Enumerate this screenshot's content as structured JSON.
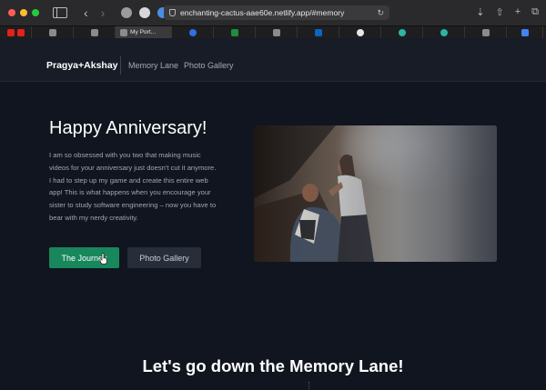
{
  "browser": {
    "url": "enchanting-cactus-aae60e.netlify.app/#memory",
    "active_tab_title": "My Port..."
  },
  "site": {
    "brand": "Pragya+Akshay",
    "nav": [
      "Memory Lane",
      "Photo Gallery"
    ],
    "hero": {
      "title": "Happy Anniversary!",
      "body": "I am so obsessed with you two that making music videos for your anniversary just doesn't cut it anymore. I had to step up my game and create this entire web app! This is what happens when you encourage your sister to study software engineering – now you have to bear with my nerdy creativity.",
      "primary_button": "The Journey",
      "secondary_button": "Photo Gallery"
    },
    "section_title": "Let's go down the Memory Lane!"
  },
  "colors": {
    "page_bg": "#10151f",
    "nav_bg": "#171c27",
    "primary_button": "#18875c",
    "secondary_button": "#272d39"
  }
}
